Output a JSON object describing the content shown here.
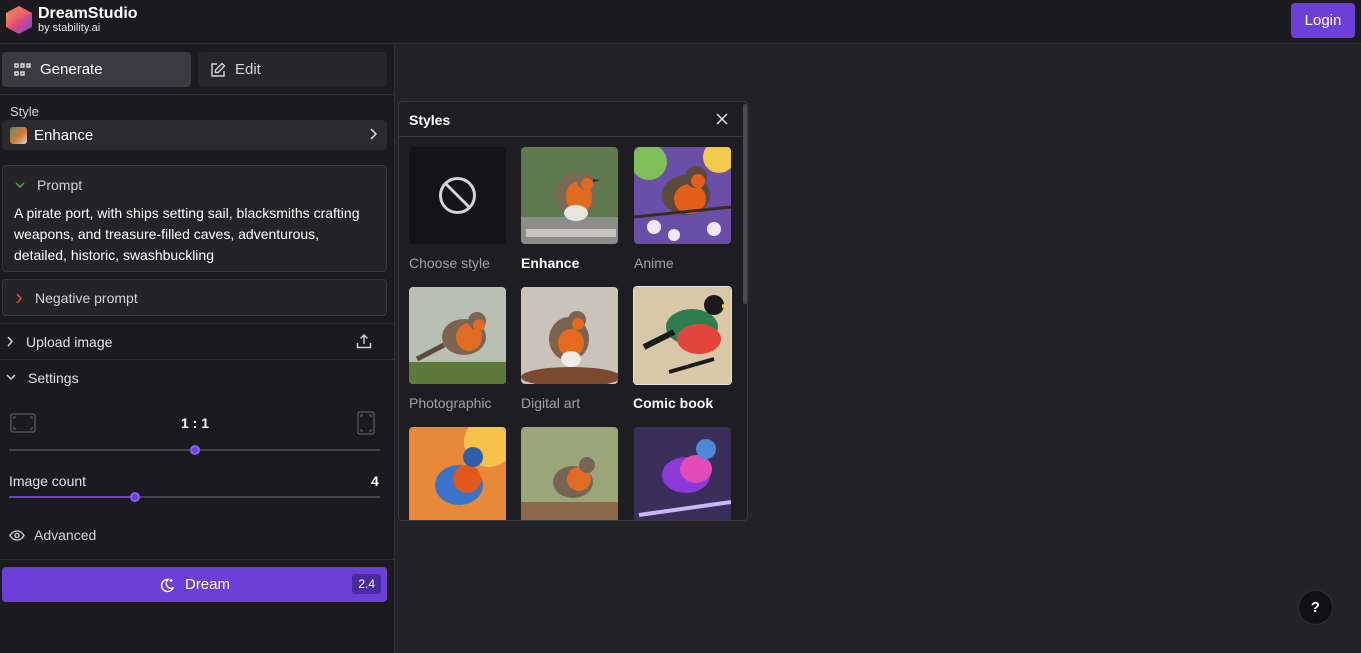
{
  "app": {
    "name": "DreamStudio",
    "subtitle": "by stability.ai",
    "login_label": "Login"
  },
  "tabs": [
    {
      "label": "Generate",
      "icon": "grid-icon",
      "active": true
    },
    {
      "label": "Edit",
      "icon": "edit-icon",
      "active": false
    }
  ],
  "style": {
    "label": "Style",
    "value": "Enhance"
  },
  "prompt": {
    "label": "Prompt",
    "text": "A pirate port, with ships setting sail, blacksmiths crafting weapons, and treasure-filled caves, adventurous, detailed, historic, swashbuckling"
  },
  "negative_prompt": {
    "label": "Negative prompt"
  },
  "upload": {
    "label": "Upload image"
  },
  "settings": {
    "label": "Settings",
    "aspect_ratio": "1 : 1",
    "aspect_slider_fraction": 0.5,
    "image_count_label": "Image count",
    "image_count": "4",
    "image_count_fraction": 0.34
  },
  "advanced": {
    "label": "Advanced"
  },
  "dream": {
    "label": "Dream",
    "cost": "2.4"
  },
  "styles_panel": {
    "title": "Styles",
    "items": [
      {
        "label": "Choose style",
        "selected": false,
        "bold": false
      },
      {
        "label": "Enhance",
        "selected": false,
        "bold": true
      },
      {
        "label": "Anime",
        "selected": false,
        "bold": false
      },
      {
        "label": "Photographic",
        "selected": false,
        "bold": false
      },
      {
        "label": "Digital art",
        "selected": false,
        "bold": false
      },
      {
        "label": "Comic book",
        "selected": true,
        "bold": true
      },
      {
        "label": "",
        "selected": false,
        "bold": false
      },
      {
        "label": "",
        "selected": false,
        "bold": false
      },
      {
        "label": "",
        "selected": false,
        "bold": false
      }
    ]
  },
  "help": {
    "label": "?"
  },
  "colors": {
    "accent": "#6d3fd9",
    "background": "#232327",
    "panel": "#1b1b1f"
  }
}
